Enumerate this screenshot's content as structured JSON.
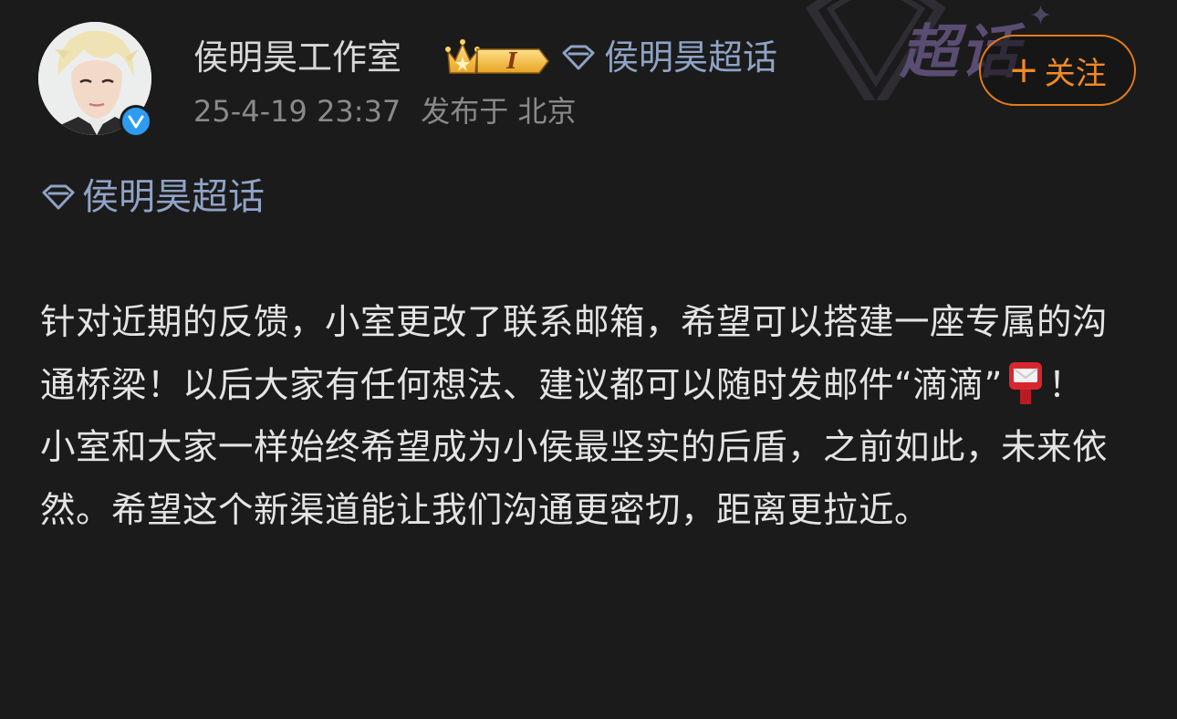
{
  "post": {
    "author_name": "侯明昊工作室",
    "author_level_badge": "I",
    "supertopic_header": "侯明昊超话",
    "timestamp": "25-4-19 23:37",
    "location_label": "发布于 北京",
    "follow_label": "关注",
    "follow_plus": "+",
    "supertopic_body": "侯明昊超话",
    "watermark_text": "超话",
    "body_paragraphs": [
      {
        "before_emoji": "针对近期的反馈，小室更改了联系邮箱，希望可以搭建一座专属的沟通桥梁！以后大家有任何想法、建议都可以随时发邮件“滴滴”",
        "after_emoji": "！"
      },
      {
        "text": "小室和大家一样始终希望成为小侯最坚实的后盾，之前如此，未来依然。希望这个新渠道能让我们沟通更密切，距离更拉近。"
      }
    ],
    "emoji_name": "postbox-emoji"
  },
  "colors": {
    "background": "#1b1b1b",
    "link": "#8fa3c6",
    "follow": "#f08a24",
    "verified": "#2d9bf0",
    "badge_gold": "#f2b531"
  }
}
